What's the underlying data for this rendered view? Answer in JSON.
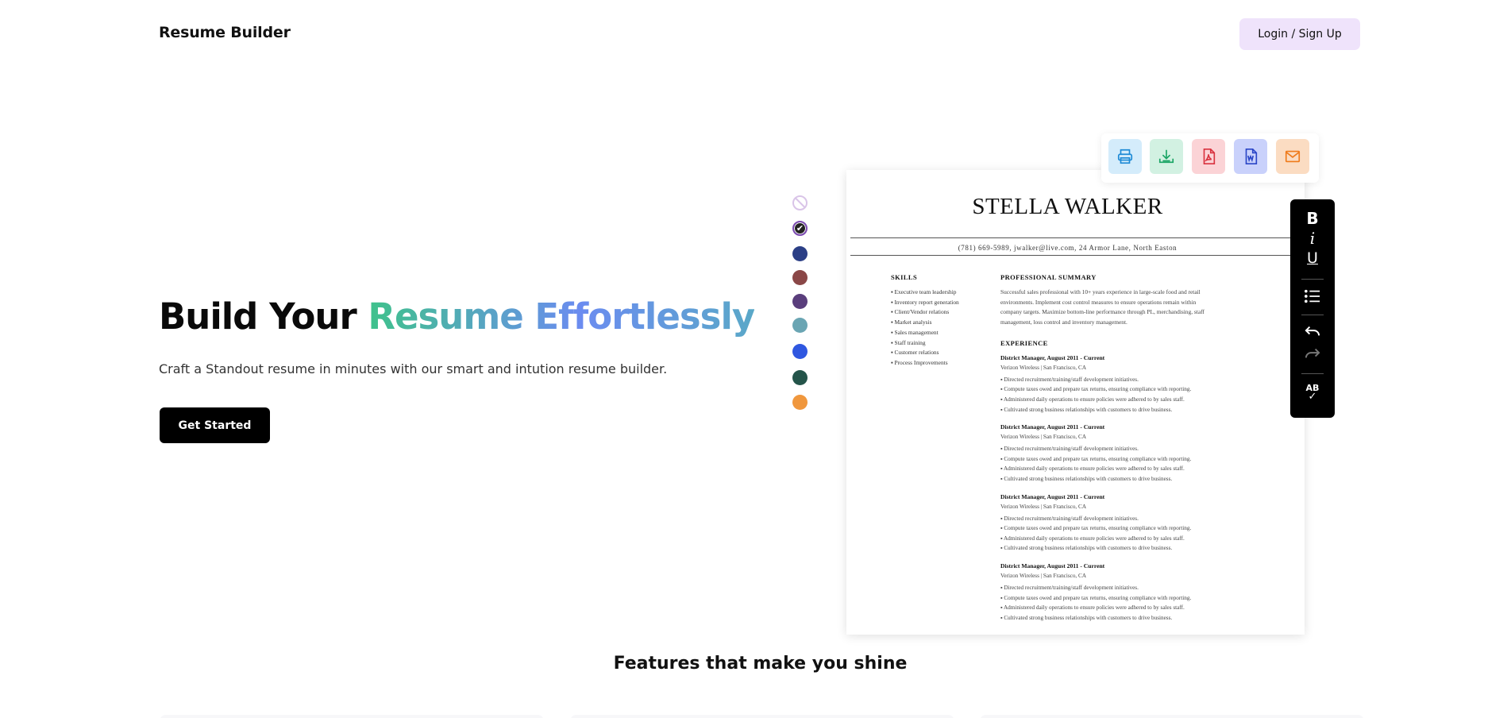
{
  "header": {
    "brand": "Resume Builder",
    "login_label": "Login / Sign Up"
  },
  "hero": {
    "title_plain": "Build Your ",
    "title_gradient": "Resume Effortlessly",
    "subtitle": "Craft a Standout resume in minutes with our smart and intution resume builder.",
    "cta_label": "Get Started"
  },
  "swatches": [
    {
      "name": "none",
      "color": "#ffffff"
    },
    {
      "name": "selected",
      "color": "#222222"
    },
    {
      "name": "navy",
      "color": "#2b3f86"
    },
    {
      "name": "brown",
      "color": "#8a4747"
    },
    {
      "name": "purple",
      "color": "#5a3e7c"
    },
    {
      "name": "teal",
      "color": "#6aa5b3"
    },
    {
      "name": "blue",
      "color": "#2f57e0"
    },
    {
      "name": "green",
      "color": "#24544a"
    },
    {
      "name": "orange",
      "color": "#f0973d"
    }
  ],
  "export_tools": [
    {
      "icon": "printer-icon",
      "bg": "#d4ecfb",
      "color": "#1d8ad6"
    },
    {
      "icon": "download-icon",
      "bg": "#d2f1e2",
      "color": "#18a463"
    },
    {
      "icon": "pdf-icon",
      "bg": "#fbd3d6",
      "color": "#d9323f"
    },
    {
      "icon": "word-icon",
      "bg": "#c9d1fb",
      "color": "#2a45c7"
    },
    {
      "icon": "email-icon",
      "bg": "#fbdcc2",
      "color": "#ef7a1a"
    }
  ],
  "format_tools": {
    "bold": "B",
    "italic": "i",
    "underline": "U",
    "spellcheck": "AB"
  },
  "resume": {
    "name": "STELLA WALKER",
    "contact": "(781) 669-5989, jwalker@live.com, 24 Armor Lane, North Easton",
    "skills_heading": "SKILLS",
    "skills": [
      "Executive team leadership",
      "Inventory report generation",
      "Client/Vendor relations",
      "Market analysis",
      "Sales management",
      "Staff training",
      "Customer relations",
      "Process Improvements"
    ],
    "summary_heading": "PROFESSIONAL SUMMARY",
    "summary": "Successful sales professional with 10+ years experience in large-scale food and retail environments. Implement cost control measures to ensure operations remain within company targets. Maximize bottom-line performance through PL, merchandising, staff management, loss control and inventory management.",
    "experience_heading": "EXPERIENCE",
    "jobs": [
      {
        "title": "District Manager, August 2011 - Current",
        "company": "Verizon Wireless | San Francisco, CA",
        "bullets": [
          "Directed recruitment/training/staff development initiatives.",
          "Compute taxes owed and prepare tax returns, ensuring compliance with reporting.",
          "Administered daily operations to ensure policies were adhered to by sales staff.",
          "Cultivated strong business relationships with customers to drive business."
        ]
      },
      {
        "title": "District Manager, August 2011 - Current",
        "company": "Verizon Wireless | San Francisco, CA",
        "bullets": [
          "Directed recruitment/training/staff development initiatives.",
          "Compute taxes owed and prepare tax returns, ensuring compliance with reporting.",
          "Administered daily operations to ensure policies were adhered to by sales staff.",
          "Cultivated strong business relationships with customers to drive business."
        ]
      },
      {
        "title": "District Manager, August 2011 - Current",
        "company": "Verizon Wireless | San Francisco, CA",
        "bullets": [
          "Directed recruitment/training/staff development initiatives.",
          "Compute taxes owed and prepare tax returns, ensuring compliance with reporting.",
          "Administered daily operations to ensure policies were adhered to by sales staff.",
          "Cultivated strong business relationships with customers to drive business."
        ]
      },
      {
        "title": "District Manager, August 2011 - Current",
        "company": "Verizon Wireless | San Francisco, CA",
        "bullets": [
          "Directed recruitment/training/staff development initiatives.",
          "Compute taxes owed and prepare tax returns, ensuring compliance with reporting.",
          "Administered daily operations to ensure policies were adhered to by sales staff.",
          "Cultivated strong business relationships with customers to drive business."
        ]
      }
    ]
  },
  "features": {
    "title": "Features that make you shine"
  }
}
